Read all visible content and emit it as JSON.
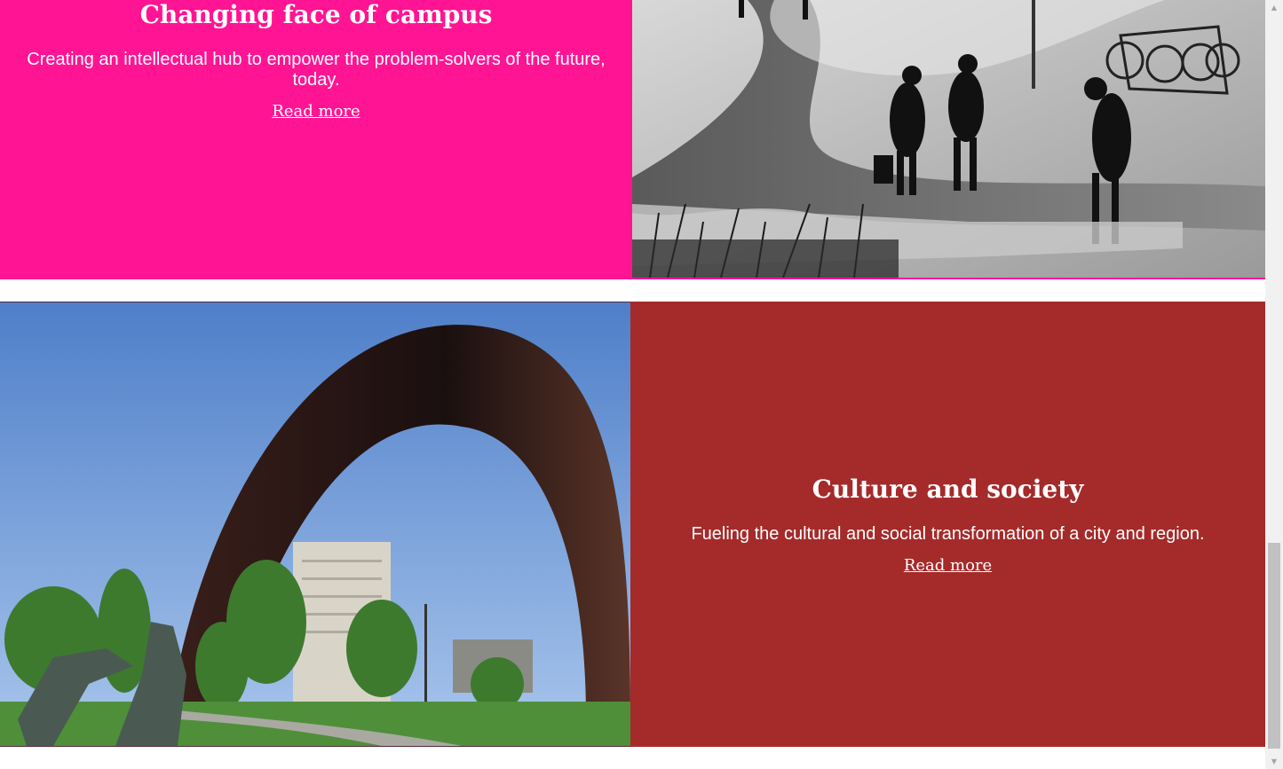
{
  "sections": [
    {
      "title": "Changing face of campus",
      "description": "Creating an intellectual hub to empower the problem-solvers of the future, today.",
      "link": "Read more",
      "background": "#ff1493",
      "image": "campus-walkway-winter-photo"
    },
    {
      "title": "Culture and society",
      "description": "Fueling the cultural and social transformation of a city and region.",
      "link": "Read more",
      "background": "#a52a2a",
      "image": "arch-sculpture-photo"
    }
  ],
  "scrollbar": {
    "up_arrow": "▲",
    "down_arrow": "▼"
  }
}
